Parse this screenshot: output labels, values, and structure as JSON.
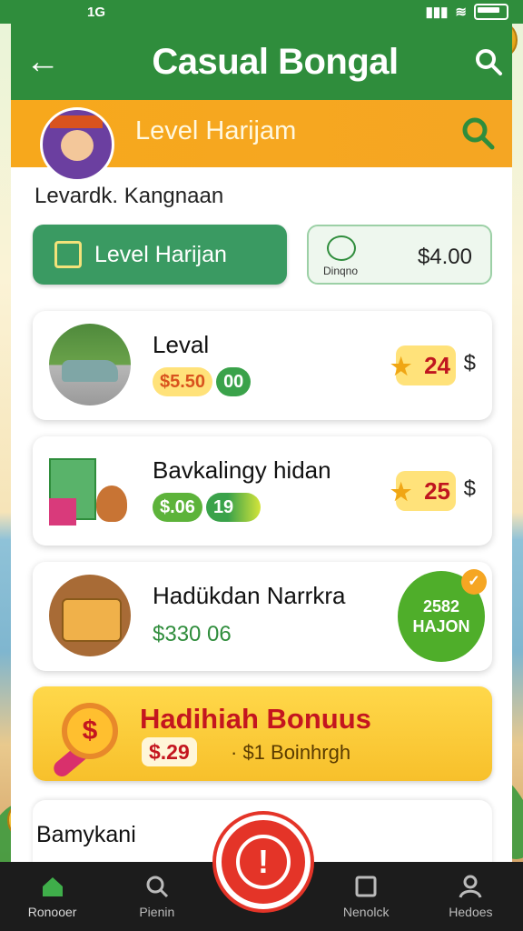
{
  "status_bar": {
    "left_text": "1G",
    "icons": [
      "signal-icon",
      "wifi-icon",
      "battery-icon"
    ]
  },
  "header": {
    "title": "Casual Bongal",
    "back_icon": "back-arrow-icon",
    "search_icon": "search-icon"
  },
  "sub_header": {
    "title": "Level Harijam",
    "search_icon": "search-icon"
  },
  "section_label": "Levardk. Kangnaan",
  "level_button": {
    "label": "Level Harijan"
  },
  "wallet": {
    "label": "Dinqno",
    "value": "$4.00"
  },
  "cards": [
    {
      "title": "Leval",
      "pill_a": "$5.50",
      "pill_b": "00",
      "reward": "24",
      "reward_suffix": "$"
    },
    {
      "title": "Bavkalingy hidan",
      "pill_a": "$.06",
      "pill_b": "19",
      "reward": "25",
      "reward_suffix": "$"
    },
    {
      "title": "Hadükdan Narrkra",
      "value": "$330 06",
      "badge_line1": "2582",
      "badge_line2": "HAJON"
    }
  ],
  "bonus": {
    "title": "Hadihiah Bonuus",
    "amount": "$.29",
    "sub": "· $1 Boinhrgh"
  },
  "partial_card": {
    "title": "Bamykani"
  },
  "bottom_nav": [
    {
      "label": "Ronooer",
      "icon": "home-icon"
    },
    {
      "label": "Pienin",
      "icon": "search-icon"
    },
    {
      "label": "Nenolck",
      "icon": "square-icon"
    },
    {
      "label": "Hedoes",
      "icon": "profile-icon"
    }
  ],
  "colors": {
    "primary_green": "#2f8d3c",
    "orange": "#f5a623",
    "red": "#e43428",
    "yellow": "#ffd84a"
  }
}
